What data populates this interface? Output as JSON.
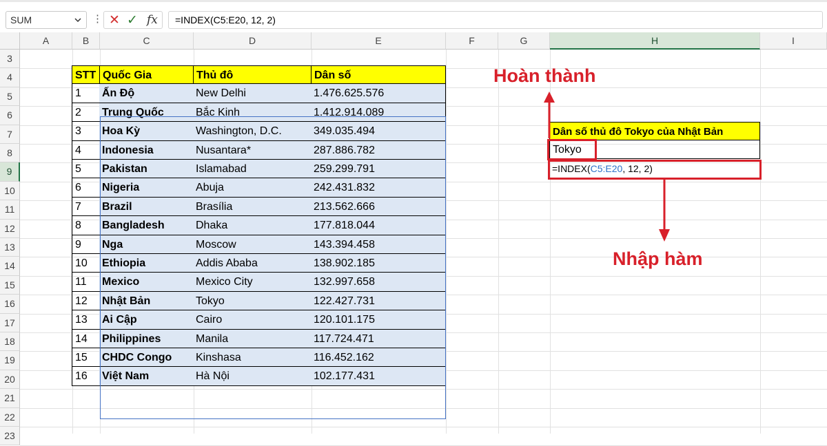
{
  "formula_bar": {
    "name_box": "SUM",
    "chevron_icon": "chevron-down-icon",
    "menu_icon": "vertical-dots-icon",
    "cancel_icon": "✕",
    "enter_icon": "✓",
    "fx_label": "fx",
    "formula": "=INDEX(C5:E20, 12, 2)"
  },
  "columns": [
    "A",
    "B",
    "C",
    "D",
    "E",
    "F",
    "G",
    "H",
    "I"
  ],
  "active_column": "H",
  "rows": [
    "3",
    "4",
    "5",
    "6",
    "7",
    "8",
    "9",
    "10",
    "11",
    "12",
    "13",
    "14",
    "15",
    "16",
    "17",
    "18",
    "19",
    "20",
    "21",
    "22",
    "23"
  ],
  "active_row": "9",
  "table": {
    "headers": [
      "STT",
      "Quốc Gia",
      "Thủ đô",
      "Dân số"
    ],
    "rows": [
      [
        "1",
        "Ấn Độ",
        "New Delhi",
        "1.476.625.576"
      ],
      [
        "2",
        "Trung Quốc",
        "Bắc Kinh",
        "1.412.914.089"
      ],
      [
        "3",
        "Hoa Kỳ",
        "Washington, D.C.",
        "349.035.494"
      ],
      [
        "4",
        "Indonesia",
        "Nusantara*",
        "287.886.782"
      ],
      [
        "5",
        "Pakistan",
        "Islamabad",
        "259.299.791"
      ],
      [
        "6",
        "Nigeria",
        "Abuja",
        "242.431.832"
      ],
      [
        "7",
        "Brazil",
        "Brasília",
        "213.562.666"
      ],
      [
        "8",
        "Bangladesh",
        "Dhaka",
        "177.818.044"
      ],
      [
        "9",
        "Nga",
        "Moscow",
        "143.394.458"
      ],
      [
        "10",
        "Ethiopia",
        "Addis Ababa",
        "138.902.185"
      ],
      [
        "11",
        "Mexico",
        "Mexico City",
        "132.997.658"
      ],
      [
        "12",
        "Nhật Bản",
        "Tokyo",
        "122.427.731"
      ],
      [
        "13",
        "Ai Cập",
        "Cairo",
        "120.101.175"
      ],
      [
        "14",
        "Philippines",
        "Manila",
        "117.724.471"
      ],
      [
        "15",
        "CHDC Congo",
        "Kinshasa",
        "116.452.162"
      ],
      [
        "16",
        "Việt Nam",
        "Hà Nội",
        "102.177.431"
      ]
    ]
  },
  "lookup": {
    "header": "Dân số thủ đô Tokyo của Nhật Bản",
    "result": "Tokyo",
    "formula_prefix": "=INDEX(",
    "formula_ref": "C5:E20",
    "formula_suffix": ", 12, 2)"
  },
  "annotations": {
    "done": "Hoàn thành",
    "enter_function": "Nhập hàm"
  },
  "colors": {
    "header_fill": "#ffff00",
    "range_fill": "#dde7f4",
    "annotation_red": "#d8202a",
    "selection_blue": "#4472c4",
    "excel_green": "#217346"
  }
}
